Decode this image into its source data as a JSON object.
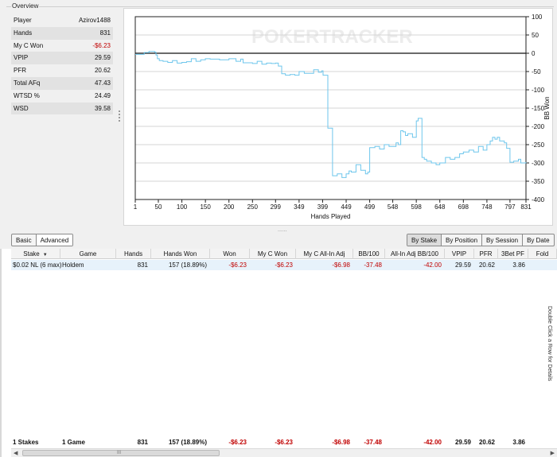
{
  "overview": {
    "title": "Overview",
    "stats": [
      {
        "label": "Player",
        "value": "Azirov1488",
        "negative": false
      },
      {
        "label": "Hands",
        "value": "831",
        "negative": false
      },
      {
        "label": "My C Won",
        "value": "-$6.23",
        "negative": true
      },
      {
        "label": "VPIP",
        "value": "29.59",
        "negative": false
      },
      {
        "label": "PFR",
        "value": "20.62",
        "negative": false
      },
      {
        "label": "Total AFq",
        "value": "47.43",
        "negative": false
      },
      {
        "label": "WTSD %",
        "value": "24.49",
        "negative": false
      },
      {
        "label": "WSD",
        "value": "39.58",
        "negative": false
      }
    ]
  },
  "chart": {
    "watermark": "POKERTRACKER",
    "x_ticks": [
      "1",
      "50",
      "100",
      "150",
      "200",
      "250",
      "299",
      "349",
      "399",
      "449",
      "499",
      "548",
      "598",
      "648",
      "698",
      "748",
      "797",
      "831"
    ],
    "y_ticks": [
      "100",
      "50",
      "0",
      "-50",
      "-100",
      "-150",
      "-200",
      "-250",
      "-300",
      "-350",
      "-400"
    ]
  },
  "chart_data": {
    "type": "line",
    "title": "",
    "xlabel": "Hands Played",
    "ylabel": "BB Won",
    "xlim": [
      1,
      831
    ],
    "ylim": [
      -400,
      100
    ],
    "grid": "horizontal",
    "series": [
      {
        "color": "#6ec6ec",
        "x": [
          1,
          20,
          30,
          42,
          45,
          48,
          52,
          60,
          70,
          80,
          90,
          100,
          110,
          120,
          130,
          140,
          150,
          160,
          180,
          200,
          215,
          225,
          230,
          250,
          260,
          270,
          280,
          290,
          299,
          305,
          312,
          320,
          330,
          340,
          349,
          360,
          370,
          380,
          390,
          397,
          400,
          410,
          420,
          430,
          440,
          449,
          455,
          460,
          470,
          480,
          490,
          495,
          499,
          510,
          520,
          530,
          540,
          548,
          555,
          560,
          565,
          570,
          575,
          580,
          590,
          598,
          602,
          610,
          615,
          620,
          630,
          640,
          648,
          660,
          670,
          680,
          690,
          698,
          710,
          720,
          730,
          740,
          748,
          755,
          760,
          765,
          770,
          775,
          785,
          790,
          797,
          805,
          815,
          820,
          831
        ],
        "y": [
          -3,
          2,
          5,
          3,
          -5,
          -15,
          -20,
          -22,
          -25,
          -20,
          -27,
          -25,
          -23,
          -15,
          -22,
          -18,
          -15,
          -16,
          -18,
          -15,
          -22,
          -16,
          -26,
          -28,
          -22,
          -30,
          -27,
          -28,
          -27,
          -35,
          -56,
          -60,
          -58,
          -60,
          -50,
          -55,
          -55,
          -45,
          -52,
          -48,
          -60,
          -205,
          -335,
          -330,
          -340,
          -330,
          -322,
          -325,
          -305,
          -320,
          -330,
          -325,
          -258,
          -255,
          -262,
          -250,
          -255,
          -255,
          -245,
          -250,
          -212,
          -215,
          -225,
          -220,
          -230,
          -185,
          -178,
          -285,
          -290,
          -295,
          -300,
          -305,
          -300,
          -285,
          -290,
          -285,
          -275,
          -270,
          -265,
          -270,
          -255,
          -265,
          -250,
          -240,
          -230,
          -235,
          -230,
          -240,
          -245,
          -260,
          -298,
          -295,
          -290,
          -300,
          -298
        ]
      }
    ]
  },
  "view_toggle": {
    "basic": "Basic",
    "advanced": "Advanced"
  },
  "group_tabs": [
    "By Stake",
    "By Position",
    "By Session",
    "By Date"
  ],
  "table": {
    "columns": [
      "Stake",
      "Game",
      "Hands",
      "Hands Won",
      "Won",
      "My C Won",
      "My C All-In Adj",
      "BB/100",
      "All-In Adj BB/100",
      "VPIP",
      "PFR",
      "3Bet PF",
      "Fold"
    ],
    "rows": [
      [
        "$0.02 NL (6 max)",
        "Holdem",
        "831",
        "157 (18.89%)",
        "-$6.23",
        "-$6.23",
        "-$6.98",
        "-37.48",
        "-42.00",
        "29.59",
        "20.62",
        "3.86",
        ""
      ]
    ],
    "totals": [
      "1 Stakes",
      "1 Game",
      "831",
      "157 (18.89%)",
      "-$6.23",
      "-$6.23",
      "-$6.98",
      "-37.48",
      "-42.00",
      "29.59",
      "20.62",
      "3.86",
      ""
    ],
    "side_caption": "Double Click a Row for Details"
  },
  "colors": {
    "negative": "#c00000",
    "line": "#6ec6ec",
    "selected_row": "#e7f2fb"
  }
}
